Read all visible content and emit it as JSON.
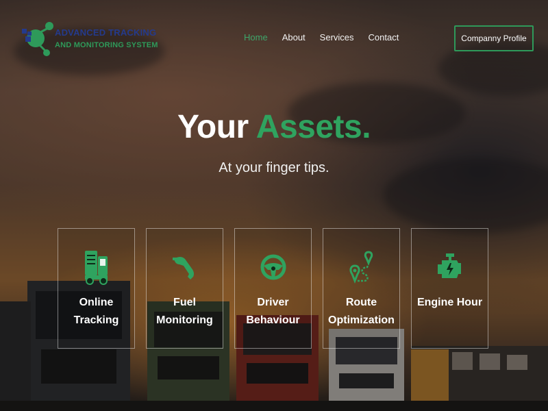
{
  "brand": {
    "line1": "ADVANCED TRACKING",
    "line2": "AND MONITORING SYSTEM",
    "color_primary": "#243a8c",
    "color_secondary": "#2e9a5a"
  },
  "nav": {
    "items": [
      {
        "label": "Home",
        "active": true
      },
      {
        "label": "About",
        "active": false
      },
      {
        "label": "Services",
        "active": false
      },
      {
        "label": "Contact",
        "active": false
      }
    ],
    "active_color": "#3ea66a"
  },
  "header": {
    "profile_button": "Companny Profile"
  },
  "hero": {
    "title_plain": "Your",
    "title_accent": "Assets.",
    "subtitle": "At your finger tips.",
    "accent_color": "#2fa35f"
  },
  "features": [
    {
      "label": "Online\nTracking",
      "icon": "truck-icon"
    },
    {
      "label": "Fuel\nMonitoring",
      "icon": "fuel-nozzle-icon"
    },
    {
      "label": "Driver\nBehaviour",
      "icon": "steering-wheel-icon"
    },
    {
      "label": "Route\nOptimization",
      "icon": "route-pins-icon"
    },
    {
      "label": "Engine Hour",
      "icon": "engine-icon"
    }
  ],
  "background": {
    "description_icon": "sunset-trucks-photo"
  }
}
